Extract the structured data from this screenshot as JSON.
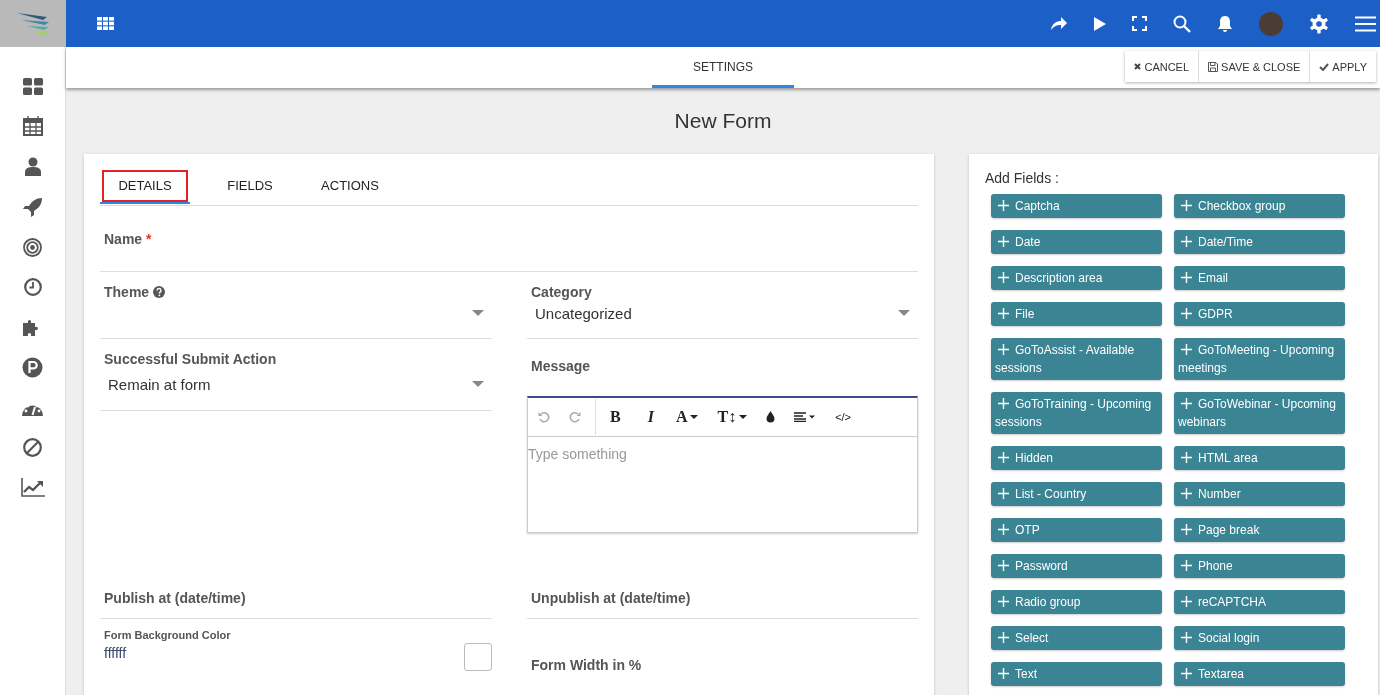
{
  "header": {
    "tabs": [
      {
        "label": "SETTINGS",
        "selected": true
      }
    ],
    "actions": [
      {
        "kind": "cancel",
        "label": "CANCEL"
      },
      {
        "kind": "save",
        "label": "SAVE & CLOSE"
      },
      {
        "kind": "apply",
        "label": "APPLY"
      }
    ]
  },
  "title": "New Form",
  "form_tabs": [
    {
      "label": "DETAILS",
      "selected": true,
      "highlighted": true
    },
    {
      "label": "FIELDS",
      "selected": false,
      "highlighted": false
    },
    {
      "label": "ACTIONS",
      "selected": false,
      "highlighted": false
    }
  ],
  "name": {
    "label": "Name",
    "required_mark": "*"
  },
  "theme": {
    "label": "Theme"
  },
  "category": {
    "label": "Category",
    "value": "Uncategorized"
  },
  "submit_action": {
    "label": "Successful Submit Action",
    "value": "Remain at form"
  },
  "message": {
    "label": "Message",
    "placeholder": "Type something",
    "toolbar": [
      {
        "kind": "undo",
        "disabled": true
      },
      {
        "kind": "redo",
        "disabled": true
      },
      {
        "kind": "bold",
        "text": "B",
        "disabled": false
      },
      {
        "kind": "italic",
        "text": "I",
        "disabled": false
      },
      {
        "kind": "font-color",
        "text": "A",
        "disabled": false
      },
      {
        "kind": "font-size",
        "text": "T↕",
        "disabled": false
      },
      {
        "kind": "color",
        "disabled": false
      },
      {
        "kind": "align",
        "disabled": false
      },
      {
        "kind": "code",
        "text": "</>",
        "disabled": false
      }
    ]
  },
  "publish": {
    "label": "Publish at (date/time)"
  },
  "unpublish": {
    "label": "Unpublish at (date/time)"
  },
  "background_color": {
    "label": "Form Background Color",
    "value": "ffffff"
  },
  "form_width": {
    "label": "Form Width in %"
  },
  "add_fields": {
    "label": "Add Fields :",
    "items": [
      "Captcha",
      "Checkbox group",
      "Date",
      "Date/Time",
      "Description area",
      "Email",
      "File",
      "GDPR",
      "GoToAssist - Available sessions",
      "GoToMeeting - Upcoming meetings",
      "GoToTraining - Upcoming sessions",
      "GoToWebinar - Upcoming webinars",
      "Hidden",
      "HTML area",
      "List - Country",
      "Number",
      "OTP",
      "Page break",
      "Password",
      "Phone",
      "Radio group",
      "reCAPTCHA",
      "Select",
      "Social login",
      "Text",
      "Textarea"
    ]
  }
}
